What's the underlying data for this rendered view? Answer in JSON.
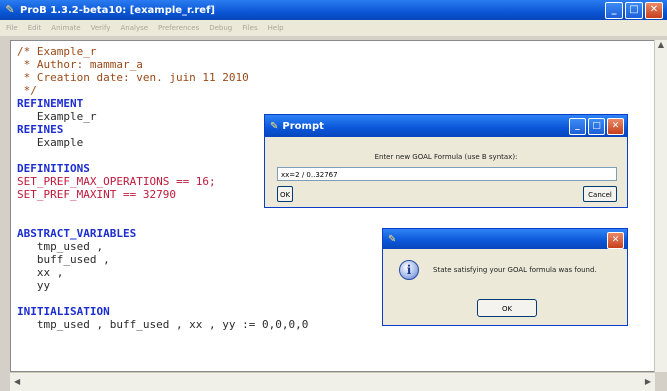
{
  "window": {
    "title": "ProB 1.3.2-beta10: [example_r.ref]",
    "title_color": "#0a56d6"
  },
  "menu": [
    "File",
    "Edit",
    "Animate",
    "Verify",
    "Analyse",
    "Preferences",
    "Debug",
    "Files",
    "Help"
  ],
  "editor": {
    "lines": [
      {
        "t": "/* Example_r",
        "c": "cm"
      },
      {
        "t": " * Author: mammar_a",
        "c": "cm"
      },
      {
        "t": " * Creation date: ven. juin 11 2010",
        "c": "cm"
      },
      {
        "t": " */",
        "c": "cm"
      },
      {
        "t": "REFINEMENT",
        "c": "kw"
      },
      {
        "t": "   Example_r",
        "c": "nm"
      },
      {
        "t": "REFINES",
        "c": "kw"
      },
      {
        "t": "   Example",
        "c": "nm"
      },
      {
        "t": "",
        "c": "nm"
      },
      {
        "t": "DEFINITIONS",
        "c": "kw"
      },
      {
        "t": "SET_PREF_MAX_OPERATIONS == 16;",
        "c": "pf"
      },
      {
        "t": "SET_PREF_MAXINT == 32790",
        "c": "pf"
      },
      {
        "t": "",
        "c": "nm"
      },
      {
        "t": "",
        "c": "nm"
      },
      {
        "t": "ABSTRACT_VARIABLES",
        "c": "kw"
      },
      {
        "t": "   tmp_used ,",
        "c": "nm"
      },
      {
        "t": "   buff_used ,",
        "c": "nm"
      },
      {
        "t": "   xx ,",
        "c": "nm"
      },
      {
        "t": "   yy",
        "c": "nm"
      },
      {
        "t": "",
        "c": "nm"
      },
      {
        "t": "INITIALISATION",
        "c": "kw"
      },
      {
        "t": "   tmp_used , buff_used , xx , yy := 0,0,0,0",
        "c": "nm"
      }
    ]
  },
  "prompt_dialog": {
    "title": "Prompt",
    "message": "Enter new GOAL Formula (use B syntax):",
    "input_value": "xx=2 / 0..32767",
    "ok_label": "OK",
    "cancel_label": "Cancel"
  },
  "info_dialog": {
    "message": "State satisfying your GOAL formula was found.",
    "ok_label": "OK",
    "icon": "info-icon"
  }
}
